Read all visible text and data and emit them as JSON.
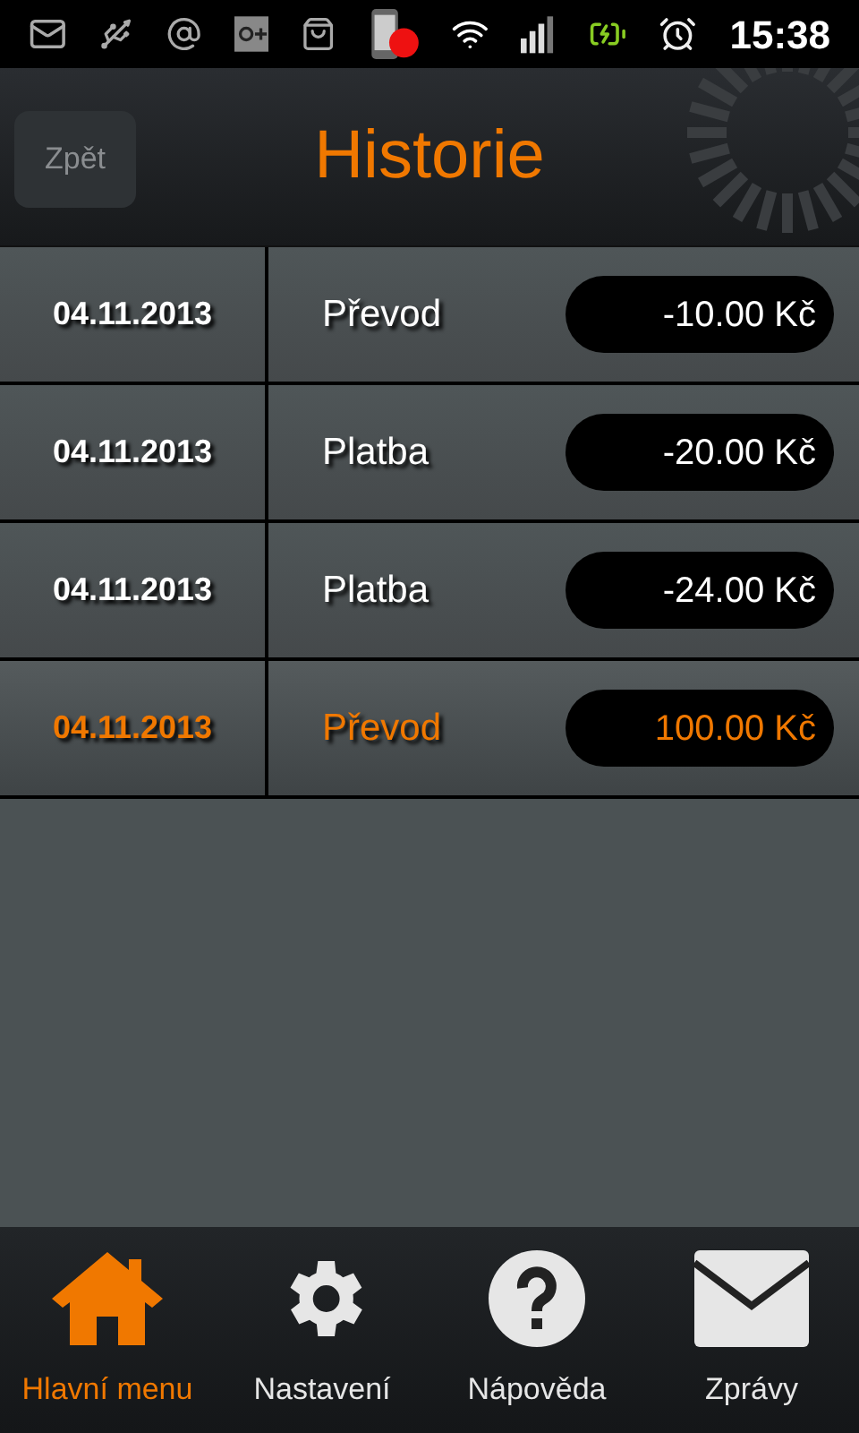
{
  "status_bar": {
    "time": "15:38"
  },
  "header": {
    "back_button": "Zpět",
    "title": "Historie"
  },
  "transactions": [
    {
      "date": "04.11.2013",
      "type": "Převod",
      "amount": "-10.00 Kč",
      "highlighted": false
    },
    {
      "date": "04.11.2013",
      "type": "Platba",
      "amount": "-20.00 Kč",
      "highlighted": false
    },
    {
      "date": "04.11.2013",
      "type": "Platba",
      "amount": "-24.00 Kč",
      "highlighted": false
    },
    {
      "date": "04.11.2013",
      "type": "Převod",
      "amount": "100.00 Kč",
      "highlighted": true
    }
  ],
  "bottom_nav": [
    {
      "kind": "home",
      "label": "Hlavní menu",
      "selected": true
    },
    {
      "kind": "settings",
      "label": "Nastavení",
      "selected": false
    },
    {
      "kind": "help",
      "label": "Nápověda",
      "selected": false
    },
    {
      "kind": "messages",
      "label": "Zprávy",
      "selected": false
    }
  ]
}
